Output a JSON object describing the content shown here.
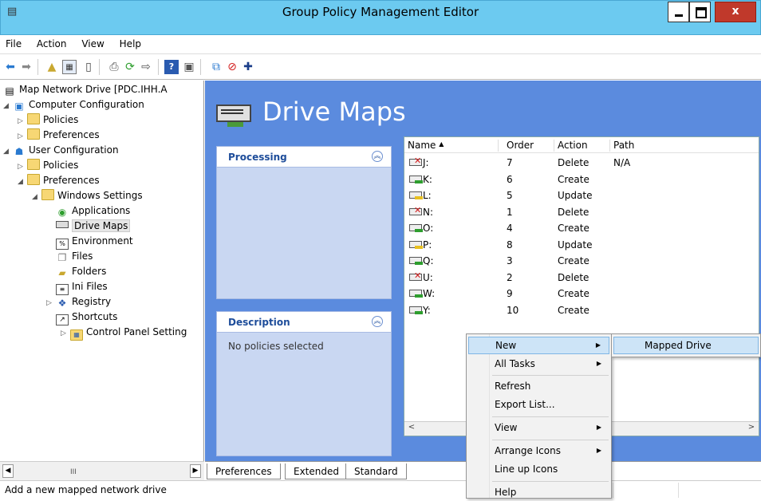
{
  "window": {
    "title": "Group Policy Management Editor"
  },
  "menubar": {
    "items": [
      "File",
      "Action",
      "View",
      "Help"
    ]
  },
  "tree": {
    "root": "Map Network Drive [PDC.IHH.A",
    "computer_config": "Computer Configuration",
    "cc_policies": "Policies",
    "cc_preferences": "Preferences",
    "user_config": "User Configuration",
    "uc_policies": "Policies",
    "uc_preferences": "Preferences",
    "windows_settings": "Windows Settings",
    "applications": "Applications",
    "drive_maps": "Drive Maps",
    "environment": "Environment",
    "files": "Files",
    "folders": "Folders",
    "ini_files": "Ini Files",
    "registry": "Registry",
    "shortcuts": "Shortcuts",
    "control_panel": "Control Panel Setting",
    "scroll_thumb": "III"
  },
  "main": {
    "heading": "Drive Maps",
    "processing_title": "Processing",
    "description_title": "Description",
    "description_text": "No policies selected"
  },
  "list": {
    "columns": [
      "Name",
      "Order",
      "Action",
      "Path"
    ],
    "sort_indicator": "▲",
    "rows": [
      {
        "name": "J:",
        "order": "7",
        "action": "Delete",
        "path": "N/A",
        "icon": "red"
      },
      {
        "name": "K:",
        "order": "6",
        "action": "Create",
        "path": "",
        "icon": "green"
      },
      {
        "name": "L:",
        "order": "5",
        "action": "Update",
        "path": "",
        "icon": "yellow"
      },
      {
        "name": "N:",
        "order": "1",
        "action": "Delete",
        "path": "",
        "icon": "red"
      },
      {
        "name": "O:",
        "order": "4",
        "action": "Create",
        "path": "",
        "icon": "green"
      },
      {
        "name": "P:",
        "order": "8",
        "action": "Update",
        "path": "",
        "icon": "yellow"
      },
      {
        "name": "Q:",
        "order": "3",
        "action": "Create",
        "path": "",
        "icon": "green"
      },
      {
        "name": "U:",
        "order": "2",
        "action": "Delete",
        "path": "",
        "icon": "red"
      },
      {
        "name": "W:",
        "order": "9",
        "action": "Create",
        "path": "",
        "icon": "green"
      },
      {
        "name": "Y:",
        "order": "10",
        "action": "Create",
        "path": "",
        "icon": "green"
      }
    ]
  },
  "tabs": [
    "Preferences",
    "Extended",
    "Standard"
  ],
  "status": {
    "message": "Add a new mapped network drive"
  },
  "context_menu": {
    "new": "New",
    "all_tasks": "All Tasks",
    "refresh": "Refresh",
    "export_list": "Export List...",
    "view": "View",
    "arrange_icons": "Arrange Icons",
    "line_up_icons": "Line up Icons",
    "help": "Help",
    "submenu_mapped_drive": "Mapped Drive"
  },
  "colors": {
    "titlebar": "#6ccaf0",
    "main_bg": "#5b8bde",
    "panel_bg": "#c9d7f2",
    "menu_highlight": "#cde4f7",
    "close_button": "#c0392b"
  }
}
